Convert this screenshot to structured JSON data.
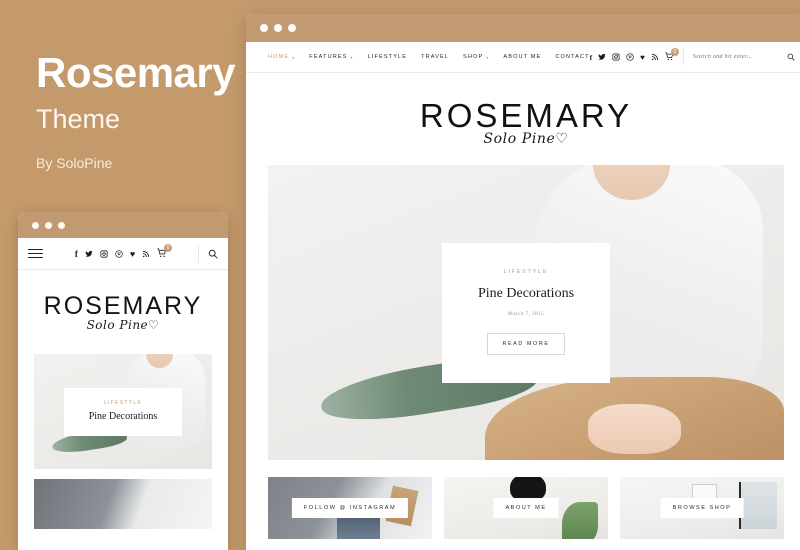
{
  "promo": {
    "title": "Rosemary",
    "subtitle": "Theme",
    "author": "By SoloPine"
  },
  "colors": {
    "background": "#c49a6c",
    "accent": "#c4a07a",
    "titlebar": "#c19a72",
    "text": "#1c1c1c"
  },
  "desktop_window": {
    "titlebar": {
      "dots": [
        "dot-1",
        "dot-2",
        "dot-3"
      ]
    },
    "menu": [
      {
        "label": "HOME",
        "has_dropdown": true,
        "active": true
      },
      {
        "label": "FEATURES",
        "has_dropdown": true,
        "active": false
      },
      {
        "label": "LIFESTYLE",
        "has_dropdown": false,
        "active": false
      },
      {
        "label": "TRAVEL",
        "has_dropdown": false,
        "active": false
      },
      {
        "label": "SHOP",
        "has_dropdown": true,
        "active": false
      },
      {
        "label": "ABOUT ME",
        "has_dropdown": false,
        "active": false
      },
      {
        "label": "CONTACT",
        "has_dropdown": false,
        "active": false
      }
    ],
    "social": [
      {
        "name": "facebook-icon",
        "glyph": "f"
      },
      {
        "name": "twitter-icon",
        "glyph": "✉"
      },
      {
        "name": "instagram-icon",
        "glyph": "▣"
      },
      {
        "name": "pinterest-icon",
        "glyph": "ⓟ"
      },
      {
        "name": "bloglovin-icon",
        "glyph": "♥"
      },
      {
        "name": "rss-icon",
        "glyph": "☢"
      }
    ],
    "cart": {
      "name": "cart-icon",
      "glyph": "Ὥ2",
      "badge": "0"
    },
    "search": {
      "placeholder": "Search and hit enter...",
      "value": "",
      "icon": "search-icon"
    },
    "logo": {
      "main": "ROSEMARY",
      "script": "Solo Pine♡"
    },
    "featured": {
      "category": "LIFESTYLE",
      "title": "Pine Decorations",
      "date": "March 7, 2015",
      "button": "READ MORE",
      "image_alt": "woman-holding-pine-branches"
    },
    "promo_boxes": [
      {
        "label": "FOLLOW @ INSTAGRAM",
        "image_alt": "woman-by-window"
      },
      {
        "label": "ABOUT ME",
        "image_alt": "woman-with-black-hat"
      },
      {
        "label": "BROWSE SHOP",
        "image_alt": "bright-interior-room"
      }
    ]
  },
  "mobile_window": {
    "titlebar": {
      "dots": [
        "dot-1",
        "dot-2",
        "dot-3"
      ]
    },
    "menu_icon": "hamburger-icon",
    "social": [
      {
        "name": "facebook-icon",
        "glyph": "f"
      },
      {
        "name": "twitter-icon",
        "glyph": "✉"
      },
      {
        "name": "instagram-icon",
        "glyph": "▣"
      },
      {
        "name": "pinterest-icon",
        "glyph": "ⓟ"
      },
      {
        "name": "bloglovin-icon",
        "glyph": "♥"
      },
      {
        "name": "rss-icon",
        "glyph": "☢"
      }
    ],
    "cart": {
      "name": "cart-icon",
      "badge": "0"
    },
    "search_icon": "search-icon",
    "logo": {
      "main": "ROSEMARY",
      "script": "Solo Pine♡"
    },
    "featured": {
      "category": "LIFESTYLE",
      "title": "Pine Decorations",
      "image_alt": "woman-holding-pine-branches"
    }
  }
}
